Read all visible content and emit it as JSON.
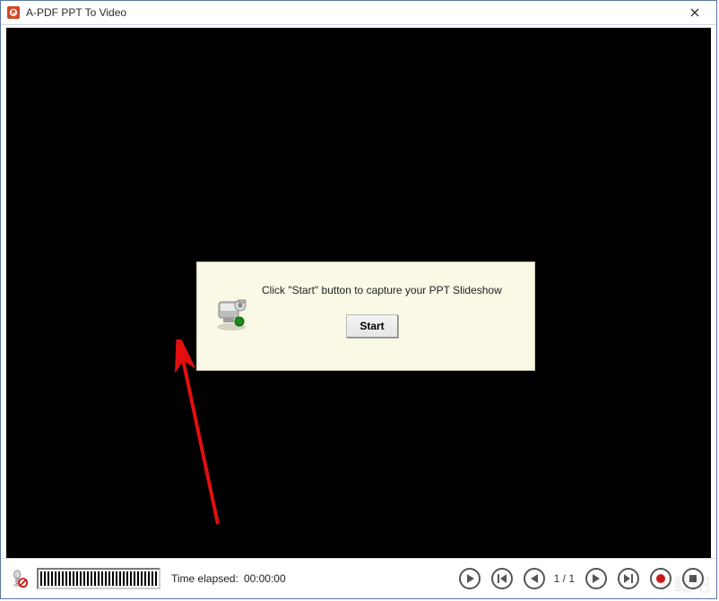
{
  "window": {
    "title": "A-PDF PPT To Video"
  },
  "dialog": {
    "instruction": "Click \"Start\" button to capture your PPT Slideshow",
    "start_label": "Start"
  },
  "status": {
    "time_label": "Time elapsed:",
    "time_value": "00:00:00",
    "page_counter": "1 / 1"
  },
  "icons": {
    "app": "powerpoint-icon",
    "close": "close-icon",
    "camera": "camera-icon",
    "mic": "microphone-icon",
    "play": "play-icon",
    "first": "first-icon",
    "prev": "previous-icon",
    "next": "next-icon",
    "last": "last-icon",
    "record": "record-icon",
    "stop": "stop-icon"
  },
  "colors": {
    "accent_border": "#5a7aa0",
    "dialog_bg": "#f9f9e6",
    "record_red": "#d21717"
  },
  "watermark": "下载吧"
}
